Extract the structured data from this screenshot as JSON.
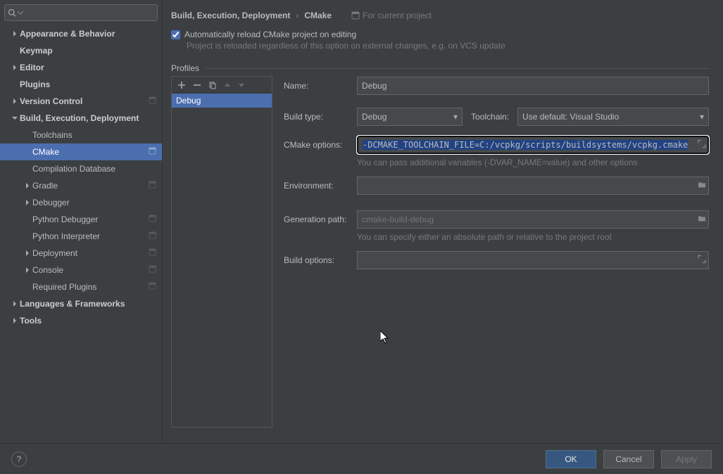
{
  "sidebar": {
    "items": [
      {
        "label": "Appearance & Behavior",
        "indent": 0,
        "bold": true,
        "arrow": "right"
      },
      {
        "label": "Keymap",
        "indent": 0,
        "bold": true,
        "arrow": "none"
      },
      {
        "label": "Editor",
        "indent": 0,
        "bold": true,
        "arrow": "right"
      },
      {
        "label": "Plugins",
        "indent": 0,
        "bold": true,
        "arrow": "none"
      },
      {
        "label": "Version Control",
        "indent": 0,
        "bold": true,
        "arrow": "right",
        "trail": true
      },
      {
        "label": "Build, Execution, Deployment",
        "indent": 0,
        "bold": true,
        "arrow": "down"
      },
      {
        "label": "Toolchains",
        "indent": 1,
        "bold": false,
        "arrow": "none"
      },
      {
        "label": "CMake",
        "indent": 1,
        "bold": false,
        "arrow": "none",
        "selected": true,
        "trail": true
      },
      {
        "label": "Compilation Database",
        "indent": 1,
        "bold": false,
        "arrow": "none"
      },
      {
        "label": "Gradle",
        "indent": 1,
        "bold": false,
        "arrow": "right",
        "trail": true
      },
      {
        "label": "Debugger",
        "indent": 1,
        "bold": false,
        "arrow": "right"
      },
      {
        "label": "Python Debugger",
        "indent": 1,
        "bold": false,
        "arrow": "none",
        "trail": true
      },
      {
        "label": "Python Interpreter",
        "indent": 1,
        "bold": false,
        "arrow": "none",
        "trail": true
      },
      {
        "label": "Deployment",
        "indent": 1,
        "bold": false,
        "arrow": "right",
        "trail": true
      },
      {
        "label": "Console",
        "indent": 1,
        "bold": false,
        "arrow": "right",
        "trail": true
      },
      {
        "label": "Required Plugins",
        "indent": 1,
        "bold": false,
        "arrow": "none",
        "trail": true
      },
      {
        "label": "Languages & Frameworks",
        "indent": 0,
        "bold": true,
        "arrow": "right"
      },
      {
        "label": "Tools",
        "indent": 0,
        "bold": true,
        "arrow": "right"
      }
    ]
  },
  "breadcrumb": {
    "a": "Build, Execution, Deployment",
    "b": "CMake",
    "hint": "For current project"
  },
  "autoreload": {
    "label": "Automatically reload CMake project on editing",
    "hint": "Project is reloaded regardless of this option on external changes, e.g. on VCS update"
  },
  "profiles": {
    "legend": "Profiles",
    "items": [
      "Debug"
    ]
  },
  "form": {
    "name_label": "Name:",
    "name_value": "Debug",
    "buildtype_label": "Build type:",
    "buildtype_value": "Debug",
    "toolchain_label": "Toolchain:",
    "toolchain_value": "Use default: Visual Studio",
    "cmakeopts_label": "CMake options:",
    "cmakeopts_value": "-DCMAKE_TOOLCHAIN_FILE=C:/vcpkg/scripts/buildsystems/vcpkg.cmake",
    "cmakeopts_hint": "You can pass additional variables (-DVAR_NAME=value) and other options",
    "env_label": "Environment:",
    "env_value": "",
    "genpath_label": "Generation path:",
    "genpath_placeholder": "cmake-build-debug",
    "genpath_hint": "You can specify either an absolute path or relative to the project root",
    "buildopts_label": "Build options:",
    "buildopts_value": ""
  },
  "footer": {
    "ok": "OK",
    "cancel": "Cancel",
    "apply": "Apply"
  }
}
